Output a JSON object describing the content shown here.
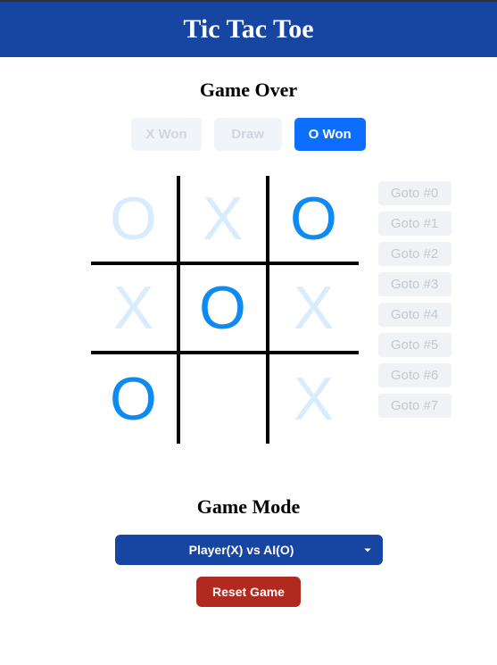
{
  "header": {
    "title": "Tic Tac Toe"
  },
  "status": {
    "label": "Game Over"
  },
  "results": [
    {
      "label": "X Won",
      "active": false
    },
    {
      "label": "Draw",
      "active": false
    },
    {
      "label": "O Won",
      "active": true
    }
  ],
  "board": {
    "cells": [
      {
        "mark": "O",
        "highlight": false
      },
      {
        "mark": "X",
        "highlight": false
      },
      {
        "mark": "O",
        "highlight": true
      },
      {
        "mark": "X",
        "highlight": false
      },
      {
        "mark": "O",
        "highlight": true
      },
      {
        "mark": "X",
        "highlight": false
      },
      {
        "mark": "O",
        "highlight": true
      },
      {
        "mark": "",
        "highlight": false
      },
      {
        "mark": "X",
        "highlight": false
      }
    ]
  },
  "history": {
    "items": [
      {
        "label": "Goto #0"
      },
      {
        "label": "Goto #1"
      },
      {
        "label": "Goto #2"
      },
      {
        "label": "Goto #3"
      },
      {
        "label": "Goto #4"
      },
      {
        "label": "Goto #5"
      },
      {
        "label": "Goto #6"
      },
      {
        "label": "Goto #7"
      }
    ]
  },
  "mode": {
    "heading": "Game Mode",
    "selected": "Player(X) vs AI(O)"
  },
  "reset": {
    "label": "Reset Game"
  }
}
